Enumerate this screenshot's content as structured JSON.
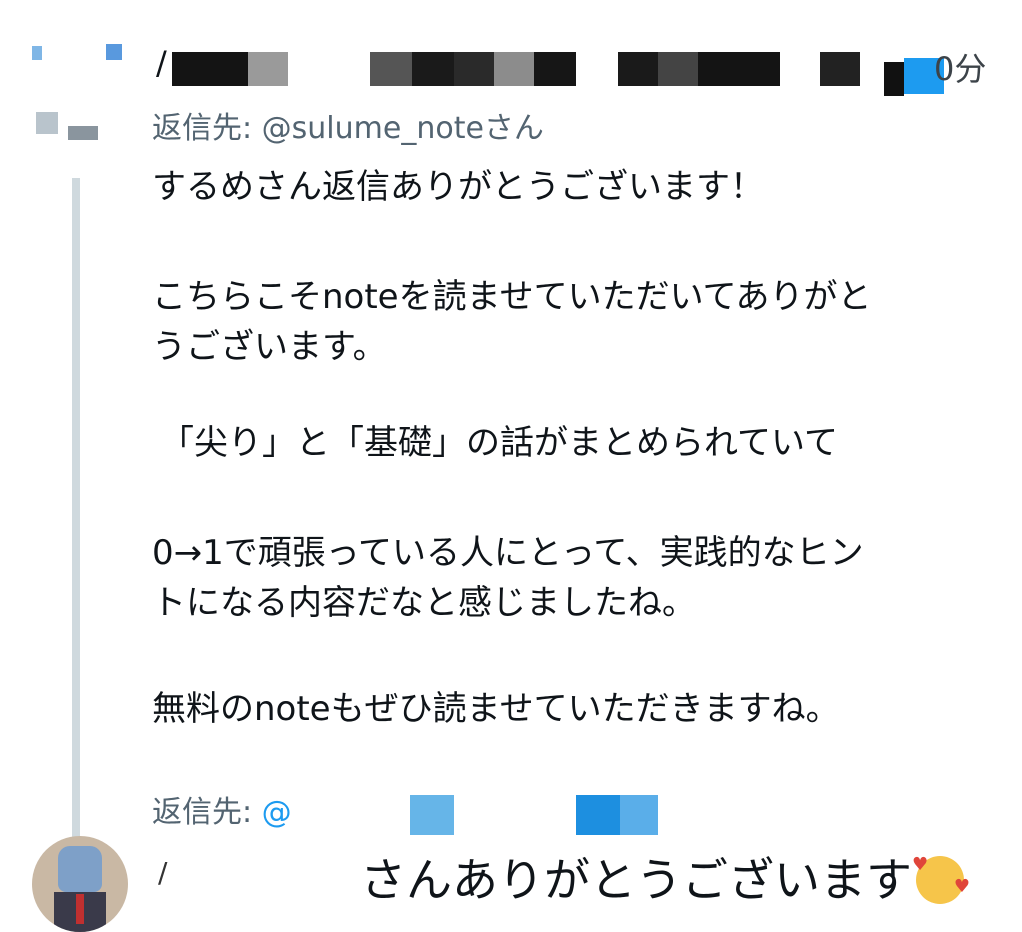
{
  "tweet1": {
    "name_fragment": "/",
    "time": "0分",
    "reply_to_label": "返信先: ",
    "reply_to_handle": "@sulume_note",
    "reply_to_suffix": "さん",
    "paragraphs": [
      "するめさん返信ありがとうございます！",
      "こちらこそnoteを読ませていただいてありがと",
      "うございます。",
      "「尖り」と「基礎」の話がまとめられていて",
      "0→1で頑張っている人にとって、実践的なヒン",
      "トになる内容だなと感じましたね。",
      "無料のnoteもぜひ読ませていただきますね。"
    ]
  },
  "tweet2": {
    "reply_to_label": "返信先: ",
    "reply_to_at": "@",
    "name_fragment": "/",
    "text": "さんありがとうございます",
    "emoji": "smiling-face-with-hearts"
  },
  "colors": {
    "text": "#0f1419",
    "secondary": "#536471",
    "link": "#1d9bf0",
    "thread_line": "#cfd9de"
  }
}
